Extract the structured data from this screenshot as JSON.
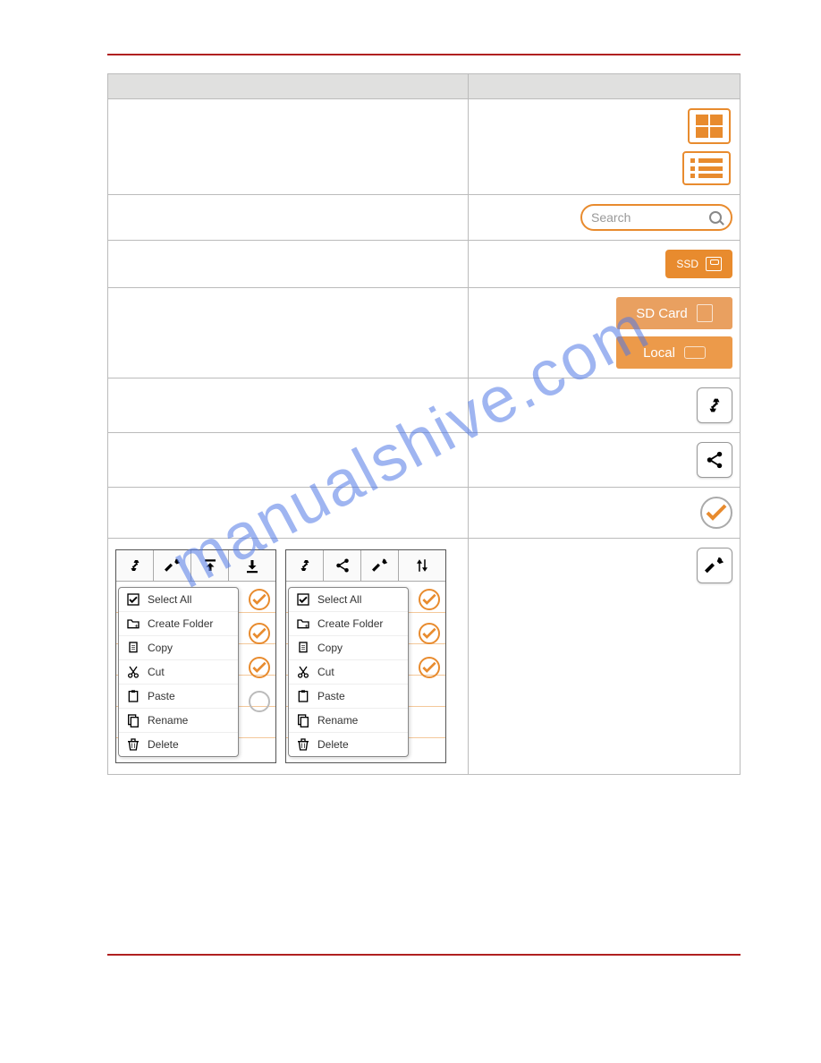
{
  "watermark": "manualshive.com",
  "search": {
    "placeholder": "Search"
  },
  "buttons": {
    "ssd": "SSD",
    "sd_card": "SD Card",
    "local": "Local"
  },
  "menu": {
    "items": [
      {
        "label": "Select All"
      },
      {
        "label": "Create Folder"
      },
      {
        "label": "Copy"
      },
      {
        "label": "Cut"
      },
      {
        "label": "Paste"
      },
      {
        "label": "Rename"
      },
      {
        "label": "Delete"
      }
    ]
  }
}
